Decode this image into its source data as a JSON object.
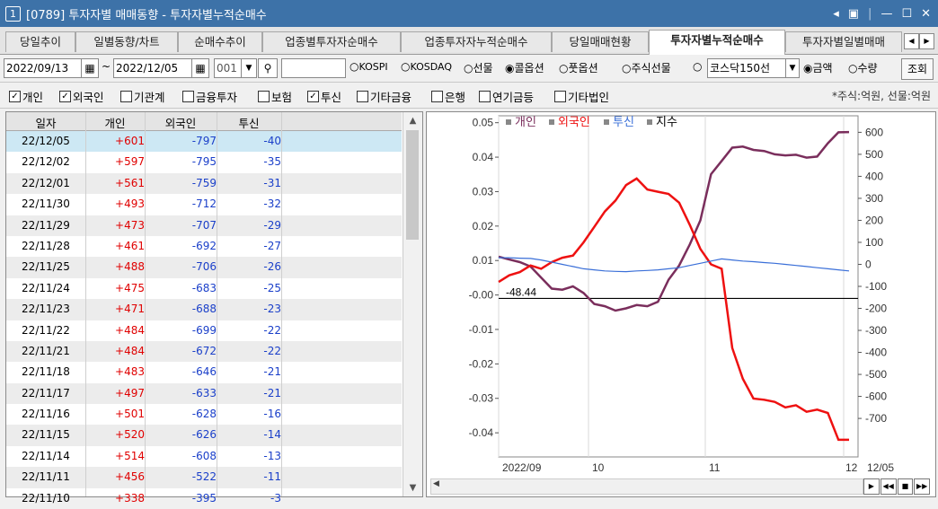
{
  "window": {
    "badge": "1",
    "title": "[0789] 투자자별 매매동향 - 투자자별누적순매수"
  },
  "tabs": [
    {
      "label": "당일추이",
      "active": false
    },
    {
      "label": "일별동향/차트",
      "active": false
    },
    {
      "label": "순매수추이",
      "active": false
    },
    {
      "label": "업종별투자자순매수",
      "active": false
    },
    {
      "label": "업종투자자누적순매수",
      "active": false
    },
    {
      "label": "당일매매현황",
      "active": false
    },
    {
      "label": "투자자별누적순매수",
      "active": true
    },
    {
      "label": "투자자별일별매매",
      "active": false
    }
  ],
  "toolbar": {
    "date_from": "2022/09/13",
    "tilde": "~",
    "date_to": "2022/12/05",
    "code": "001",
    "search_value": "",
    "radio_market": [
      {
        "label": "KOSPI",
        "checked": false
      },
      {
        "label": "KOSDAQ",
        "checked": false
      },
      {
        "label": "선물",
        "checked": false
      },
      {
        "label": "콜옵션",
        "checked": true
      },
      {
        "label": "풋옵션",
        "checked": false
      },
      {
        "label": "주식선물",
        "checked": false
      },
      {
        "label": "",
        "checked": false
      }
    ],
    "index_select": "코스닥150선",
    "radio_type": [
      {
        "label": "금액",
        "checked": true
      },
      {
        "label": "수량",
        "checked": false
      }
    ],
    "query_button": "조회"
  },
  "filters": [
    {
      "label": "개인",
      "checked": true
    },
    {
      "label": "외국인",
      "checked": true
    },
    {
      "label": "기관계",
      "checked": false
    },
    {
      "label": "금융투자",
      "checked": false
    },
    {
      "label": "보험",
      "checked": false
    },
    {
      "label": "투신",
      "checked": true
    },
    {
      "label": "기타금융",
      "checked": false
    },
    {
      "label": "은행",
      "checked": false
    },
    {
      "label": "연기금등",
      "checked": false
    },
    {
      "label": "기타법인",
      "checked": false
    }
  ],
  "unit_text": "*주식:억원, 선물:억원",
  "table": {
    "headers": [
      "일자",
      "개인",
      "외국인",
      "투신"
    ],
    "rows": [
      [
        "22/12/05",
        "+601",
        "-797",
        "-40"
      ],
      [
        "22/12/02",
        "+597",
        "-795",
        "-35"
      ],
      [
        "22/12/01",
        "+561",
        "-759",
        "-31"
      ],
      [
        "22/11/30",
        "+493",
        "-712",
        "-32"
      ],
      [
        "22/11/29",
        "+473",
        "-707",
        "-29"
      ],
      [
        "22/11/28",
        "+461",
        "-692",
        "-27"
      ],
      [
        "22/11/25",
        "+488",
        "-706",
        "-26"
      ],
      [
        "22/11/24",
        "+475",
        "-683",
        "-25"
      ],
      [
        "22/11/23",
        "+471",
        "-688",
        "-23"
      ],
      [
        "22/11/22",
        "+484",
        "-699",
        "-22"
      ],
      [
        "22/11/21",
        "+484",
        "-672",
        "-22"
      ],
      [
        "22/11/18",
        "+483",
        "-646",
        "-21"
      ],
      [
        "22/11/17",
        "+497",
        "-633",
        "-21"
      ],
      [
        "22/11/16",
        "+501",
        "-628",
        "-16"
      ],
      [
        "22/11/15",
        "+520",
        "-626",
        "-14"
      ],
      [
        "22/11/14",
        "+514",
        "-608",
        "-13"
      ],
      [
        "22/11/11",
        "+456",
        "-522",
        "-11"
      ],
      [
        "22/11/10",
        "+338",
        "-395",
        "-3"
      ]
    ]
  },
  "chart_data": {
    "type": "line",
    "legend": [
      {
        "name": "개인",
        "color": "#7a2e5c"
      },
      {
        "name": "외국인",
        "color": "#ee1111"
      },
      {
        "name": "투신",
        "color": "#3a6fd8"
      },
      {
        "name": "지수",
        "color": "#000000"
      }
    ],
    "left_axis": {
      "ticks": [
        "0.05",
        "0.04",
        "0.03",
        "0.02",
        "0.01",
        "-0.00",
        "-0.01",
        "-0.02",
        "-0.03",
        "-0.04"
      ],
      "range": [
        -0.047,
        0.052
      ]
    },
    "right_axis": {
      "ticks": [
        "600",
        "500",
        "400",
        "300",
        "200",
        "100",
        "0",
        "-100",
        "-200",
        "-300",
        "-400",
        "-500",
        "-600",
        "-700"
      ],
      "range": [
        -875,
        675
      ]
    },
    "x_labels": [
      "2022/09",
      "10",
      "11",
      "12",
      "12/05"
    ],
    "annotation": "-48.44",
    "index_level": -0.001,
    "series": [
      {
        "name": "개인",
        "color": "#7a2e5c",
        "values": [
          35,
          22,
          10,
          -10,
          -60,
          -110,
          -115,
          -100,
          -130,
          -180,
          -190,
          -210,
          -200,
          -185,
          -190,
          -170,
          -70,
          -5,
          90,
          200,
          410,
          470,
          530,
          535,
          520,
          515,
          500,
          495,
          498,
          485,
          490,
          550,
          600,
          601
        ]
      },
      {
        "name": "외국인",
        "color": "#ee1111",
        "values": [
          -80,
          -50,
          -35,
          -5,
          -20,
          10,
          30,
          40,
          100,
          170,
          240,
          290,
          360,
          390,
          340,
          330,
          320,
          280,
          180,
          70,
          0,
          -20,
          -380,
          -520,
          -610,
          -615,
          -625,
          -650,
          -640,
          -670,
          -660,
          -675,
          -797,
          -797
        ]
      },
      {
        "name": "투신",
        "color": "#3a6fd8",
        "values": [
          30,
          30,
          28,
          27,
          20,
          10,
          0,
          -10,
          -20,
          -25,
          -30,
          -32,
          -33,
          -30,
          -28,
          -25,
          -20,
          -15,
          -5,
          5,
          15,
          25,
          20,
          15,
          12,
          8,
          5,
          0,
          -5,
          -10,
          -15,
          -20,
          -25,
          -30
        ]
      },
      {
        "name": "지수",
        "color": "#000000",
        "values": []
      }
    ]
  }
}
